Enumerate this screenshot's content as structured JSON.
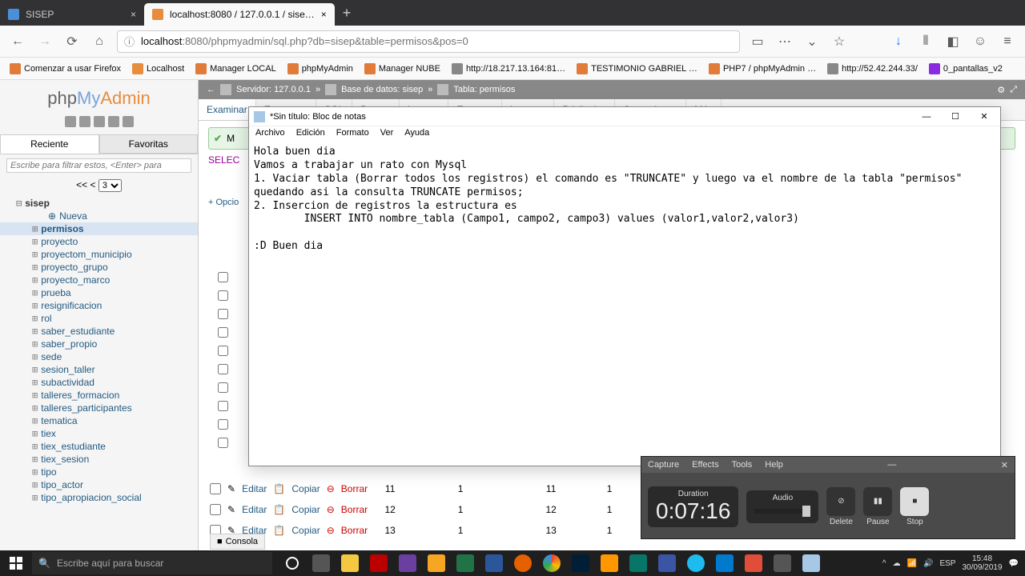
{
  "browser": {
    "tabs": [
      {
        "title": "SISEP",
        "active": false
      },
      {
        "title": "localhost:8080 / 127.0.0.1 / sise…",
        "active": true
      }
    ],
    "url_prefix": "localhost",
    "url_rest": ":8080/phpmyadmin/sql.php?db=sisep&table=permisos&pos=0",
    "bookmarks": [
      "Comenzar a usar Firefox",
      "Localhost",
      "Manager LOCAL",
      "phpMyAdmin",
      "Manager NUBE",
      "http://18.217.13.164:81…",
      "TESTIMONIO GABRIEL …",
      "PHP7 / phpMyAdmin …",
      "http://52.42.244.33/",
      "0_pantallas_v2"
    ]
  },
  "pma": {
    "logo_parts": {
      "php": "php",
      "my": "My",
      "admin": "Admin"
    },
    "side_tabs": {
      "recent": "Reciente",
      "fav": "Favoritas"
    },
    "filter_placeholder": "Escribe para filtrar estos, <Enter> para",
    "pager": {
      "arrows": "<< <",
      "page": "3"
    },
    "db": "sisep",
    "new_label": "Nueva",
    "tables": [
      "permisos",
      "proyecto",
      "proyectom_municipio",
      "proyecto_grupo",
      "proyecto_marco",
      "prueba",
      "resignificacion",
      "rol",
      "saber_estudiante",
      "saber_propio",
      "sede",
      "sesion_taller",
      "subactividad",
      "talleres_formacion",
      "talleres_participantes",
      "tematica",
      "tiex",
      "tiex_estudiante",
      "tiex_sesion",
      "tipo",
      "tipo_actor",
      "tipo_apropiacion_social"
    ],
    "selected_table": "permisos",
    "breadcrumb": {
      "server": "Servidor: 127.0.0.1",
      "db": "Base de datos: sisep",
      "table": "Tabla: permisos"
    },
    "inner_tabs": [
      "Examinar",
      "Estructura",
      "SQL",
      "Buscar",
      "Insertar",
      "Exportar",
      "Importar",
      "Privilegios",
      "Operaciones",
      "Más"
    ],
    "success_prefix": "M",
    "sql_prefix": "SELEC",
    "options": "+ Opcio",
    "row_actions": {
      "edit": "Editar",
      "copy": "Copiar",
      "delete": "Borrar"
    },
    "rows": [
      {
        "id": "11",
        "a": "1",
        "b": "11",
        "c": "1"
      },
      {
        "id": "12",
        "a": "1",
        "b": "12",
        "c": "1"
      },
      {
        "id": "13",
        "a": "1",
        "b": "13",
        "c": "1"
      }
    ],
    "console": "Consola"
  },
  "notepad": {
    "title": "*Sin título: Bloc de notas",
    "menu": [
      "Archivo",
      "Edición",
      "Formato",
      "Ver",
      "Ayuda"
    ],
    "body": "Hola buen dia\nVamos a trabajar un rato con Mysql\n1. Vaciar tabla (Borrar todos los registros) el comando es \"TRUNCATE\" y luego va el nombre de la tabla \"permisos\"\nquedando asi la consulta TRUNCATE permisos;\n2. Insercion de registros la estructura es\n        INSERT INTO nombre_tabla (Campo1, campo2, campo3) values (valor1,valor2,valor3)\n\n:D Buen dia"
  },
  "recorder": {
    "menu": [
      "Capture",
      "Effects",
      "Tools",
      "Help"
    ],
    "duration_label": "Duration",
    "duration": "0:07:16",
    "audio_label": "Audio",
    "buttons": {
      "delete": "Delete",
      "pause": "Pause",
      "stop": "Stop"
    }
  },
  "taskbar": {
    "search_placeholder": "Escribe aquí para buscar",
    "lang": "ESP",
    "time": "15:48",
    "date": "30/09/2019"
  }
}
